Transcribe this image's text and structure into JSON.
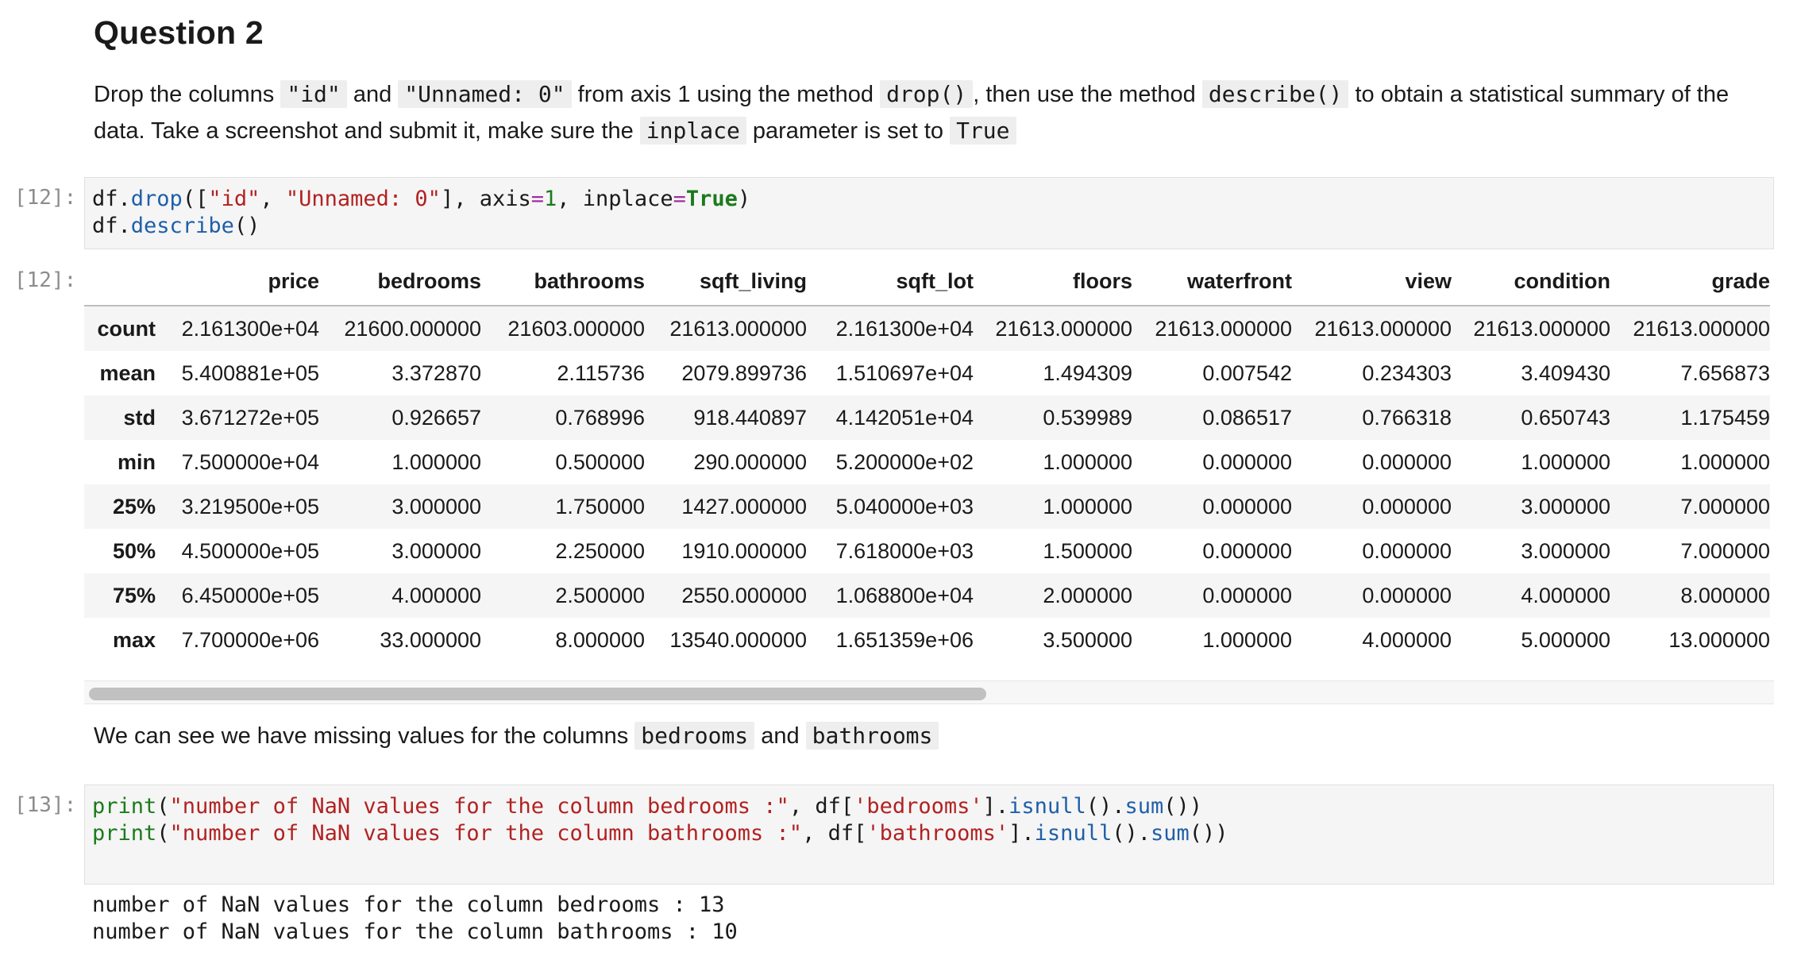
{
  "markdown_q2": {
    "heading": "Question 2",
    "text_1": "Drop the columns",
    "code_id": "\"id\"",
    "text_2": "and",
    "code_unnamed": "\"Unnamed: 0\"",
    "text_3": "from axis 1 using the method",
    "code_drop": "drop()",
    "text_4": ", then use the method",
    "code_describe": "describe()",
    "text_5": "to obtain a statistical summary of the data. Take a screenshot and submit it, make sure the",
    "code_inplace": "inplace",
    "text_6": "parameter is set to",
    "code_true": "True"
  },
  "cell_12": {
    "in_prompt": "[12]:",
    "out_prompt": "[12]:",
    "line1": {
      "a": "df.",
      "b": "drop",
      "c": "([",
      "d": "\"id\"",
      "e": ", ",
      "f": "\"Unnamed: 0\"",
      "g": "], axis",
      "h": "=",
      "i": "1",
      "j": ", inplace",
      "k": "=",
      "l": "True",
      "m": ")"
    },
    "line2": {
      "a": "df.",
      "b": "describe",
      "c": "()"
    }
  },
  "describe_table": {
    "columns": [
      "",
      "price",
      "bedrooms",
      "bathrooms",
      "sqft_living",
      "sqft_lot",
      "floors",
      "waterfront",
      "view",
      "condition",
      "grade"
    ],
    "rows": [
      [
        "count",
        "2.161300e+04",
        "21600.000000",
        "21603.000000",
        "21613.000000",
        "2.161300e+04",
        "21613.000000",
        "21613.000000",
        "21613.000000",
        "21613.000000",
        "21613.000000"
      ],
      [
        "mean",
        "5.400881e+05",
        "3.372870",
        "2.115736",
        "2079.899736",
        "1.510697e+04",
        "1.494309",
        "0.007542",
        "0.234303",
        "3.409430",
        "7.656873"
      ],
      [
        "std",
        "3.671272e+05",
        "0.926657",
        "0.768996",
        "918.440897",
        "4.142051e+04",
        "0.539989",
        "0.086517",
        "0.766318",
        "0.650743",
        "1.175459"
      ],
      [
        "min",
        "7.500000e+04",
        "1.000000",
        "0.500000",
        "290.000000",
        "5.200000e+02",
        "1.000000",
        "0.000000",
        "0.000000",
        "1.000000",
        "1.000000"
      ],
      [
        "25%",
        "3.219500e+05",
        "3.000000",
        "1.750000",
        "1427.000000",
        "5.040000e+03",
        "1.000000",
        "0.000000",
        "0.000000",
        "3.000000",
        "7.000000"
      ],
      [
        "50%",
        "4.500000e+05",
        "3.000000",
        "2.250000",
        "1910.000000",
        "7.618000e+03",
        "1.500000",
        "0.000000",
        "0.000000",
        "3.000000",
        "7.000000"
      ],
      [
        "75%",
        "6.450000e+05",
        "4.000000",
        "2.500000",
        "2550.000000",
        "1.068800e+04",
        "2.000000",
        "0.000000",
        "0.000000",
        "4.000000",
        "8.000000"
      ],
      [
        "max",
        "7.700000e+06",
        "33.000000",
        "8.000000",
        "13540.000000",
        "1.651359e+06",
        "3.500000",
        "1.000000",
        "4.000000",
        "5.000000",
        "13.000000"
      ]
    ]
  },
  "markdown_missing": {
    "text_1": "We can see we have missing values for the columns",
    "code_bedrooms": "bedrooms",
    "text_2": "and",
    "code_bathrooms": "bathrooms"
  },
  "cell_13": {
    "in_prompt": "[13]:",
    "line1": {
      "a": "print",
      "b": "(",
      "c": "\"number of NaN values for the column bedrooms :\"",
      "d": ", df[",
      "e": "'bedrooms'",
      "f": "].",
      "g": "isnull",
      "h": "().",
      "i": "sum",
      "j": "())"
    },
    "line2": {
      "a": "print",
      "b": "(",
      "c": "\"number of NaN values for the column bathrooms :\"",
      "d": ", df[",
      "e": "'bathrooms'",
      "f": "].",
      "g": "isnull",
      "h": "().",
      "i": "sum",
      "j": "())"
    },
    "stdout": [
      "number of NaN values for the column bedrooms : 13",
      "number of NaN values for the column bathrooms : 10"
    ]
  }
}
